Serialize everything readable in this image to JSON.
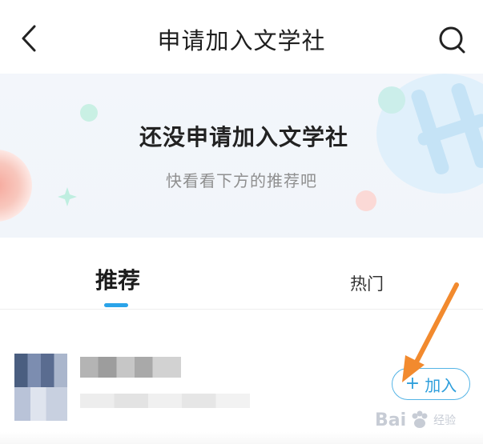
{
  "header": {
    "title": "申请加入文学社",
    "back_icon": "chevron-left-icon",
    "search_icon": "search-icon"
  },
  "empty_state": {
    "title": "还没申请加入文学社",
    "subtitle": "快看看下方的推荐吧"
  },
  "tabs": [
    {
      "label": "推荐",
      "active": true
    },
    {
      "label": "热门",
      "active": false
    }
  ],
  "list": [
    {
      "join_label": "加入",
      "join_icon": "plus-icon"
    }
  ],
  "watermark": {
    "text": "Bai",
    "suffix": "经验"
  },
  "colors": {
    "accent": "#2aa3e9",
    "join_border": "#54b4e6",
    "annotation_arrow": "#f28a2e"
  }
}
